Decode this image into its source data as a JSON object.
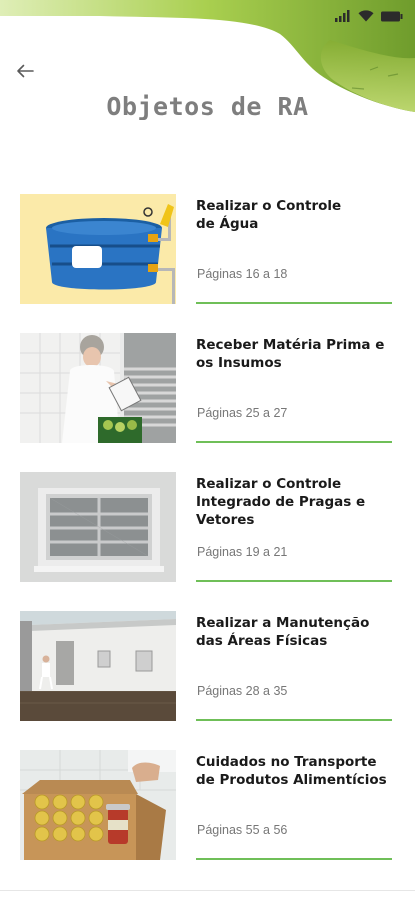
{
  "header": {
    "title": "Objetos de RA",
    "back_icon": "arrow-left-icon",
    "accent": "#6fbf58"
  },
  "status_bar": {
    "icons": [
      "cellular-signal-icon",
      "wifi-icon",
      "battery-icon"
    ]
  },
  "items": [
    {
      "title": "Realizar o Controle\nde Água",
      "pages": "Páginas 16 a 18",
      "image": "water-tank-illustration"
    },
    {
      "title": "Receber Matéria Prima e os Insumos",
      "pages": "Páginas 25 a 27",
      "image": "inspector-clipboard-photo"
    },
    {
      "title": "Realizar o Controle Integrado de Pragas e Vetores",
      "pages": "Páginas 19 a 21",
      "image": "screened-window-photo"
    },
    {
      "title": "Realizar a Manutenção das Áreas Físicas",
      "pages": "Páginas 28 a 35",
      "image": "building-exterior-photo"
    },
    {
      "title": "Cuidados no Transporte de Produtos Alimentícios",
      "pages": "Páginas 55 a 56",
      "image": "food-jars-box-photo"
    }
  ]
}
